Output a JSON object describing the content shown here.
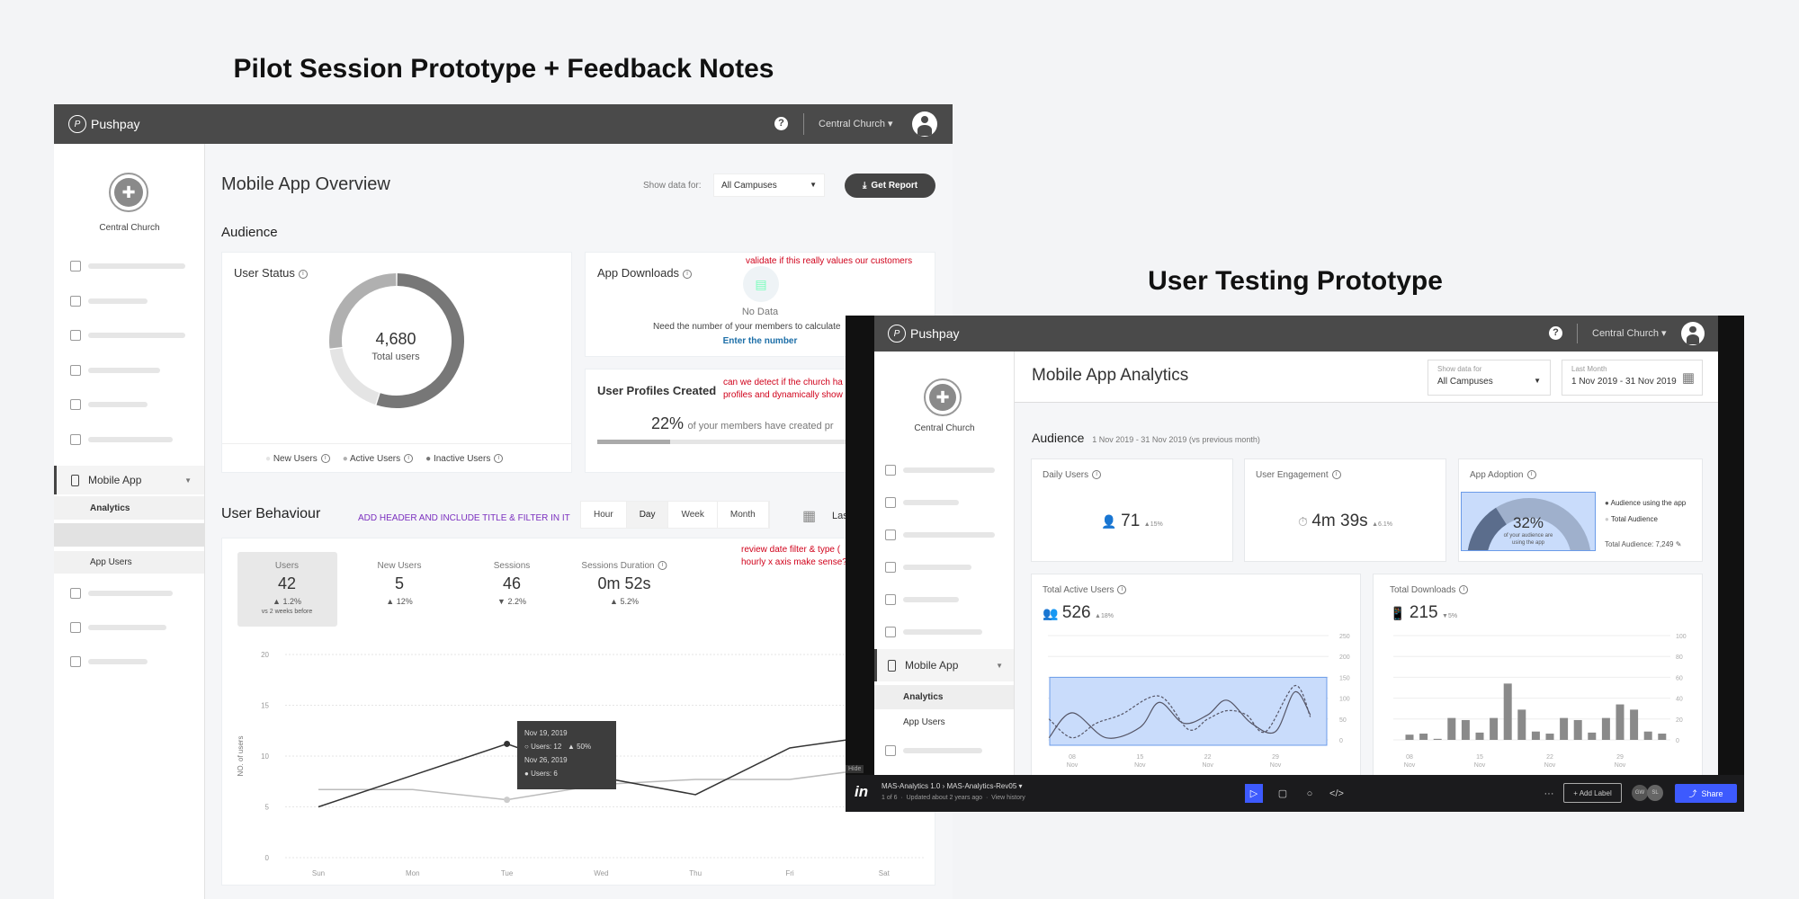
{
  "headings": {
    "left": "Pilot Session Prototype + Feedback Notes",
    "right": "User Testing Prototype"
  },
  "pilot": {
    "topbar": {
      "brand": "Pushpay",
      "help": "?",
      "church": "Central Church ▾"
    },
    "sidebar": {
      "church": "Central Church",
      "mobile_app": "Mobile App",
      "analytics": "Analytics",
      "app_users": "App Users"
    },
    "page_title": "Mobile App Overview",
    "show_data_label": "Show data for:",
    "campus_select": "All Campuses",
    "get_report": "Get Report",
    "audience": "Audience",
    "user_status": {
      "title": "User Status",
      "total": "4,680",
      "total_label": "Total users",
      "segments": [
        {
          "name": "Inactive Users",
          "fraction": 0.55,
          "color": "#777777"
        },
        {
          "name": "New Users",
          "fraction": 0.18,
          "color": "#e4e4e4"
        },
        {
          "name": "Active Users",
          "fraction": 0.27,
          "color": "#b0b0b0"
        }
      ],
      "legend": [
        "New Users",
        "Active Users",
        "Inactive Users"
      ]
    },
    "app_downloads": {
      "title": "App Downloads",
      "no_data": "No Data",
      "message": "Need the number of your members to calculate",
      "link": "Enter the number",
      "note": "validate if this really values our customers"
    },
    "user_profiles": {
      "title": "User Profiles Created",
      "percent": "22%",
      "text": "of your members have created pr",
      "progress": 0.22,
      "note": [
        "can we detect if the church ha",
        "profiles and dynamically show"
      ]
    },
    "behaviour": {
      "title": "User Behaviour",
      "note": "ADD HEADER AND INCLUDE TITLE & FILTER IN IT",
      "tabs": [
        "Hour",
        "Day",
        "Week",
        "Month"
      ],
      "selected_tab": "Day",
      "date_partial": "Las",
      "stats": [
        {
          "label": "Users",
          "value": "42",
          "change": "▲ 1.2%",
          "sub": "vs 2 weeks before"
        },
        {
          "label": "New Users",
          "value": "5",
          "change": "▲ 12%"
        },
        {
          "label": "Sessions",
          "value": "46",
          "change": "▼ 2.2%"
        },
        {
          "label": "Sessions Duration",
          "value": "0m 52s",
          "change": "▲ 5.2%"
        }
      ],
      "note2": [
        "review date filter & type (",
        "hourly x axis make sense?"
      ],
      "tooltip": {
        "date1": "Nov 19, 2019",
        "users1": "Users: 12",
        "change1": "▲ 50%",
        "date2": "Nov 26, 2019",
        "users2": "Users: 6"
      }
    }
  },
  "testing": {
    "topbar": {
      "brand": "Pushpay",
      "help": "?",
      "church": "Central Church ▾"
    },
    "sidebar": {
      "church": "Central Church",
      "mobile_app": "Mobile App",
      "analytics": "Analytics",
      "app_users": "App Users"
    },
    "page_title": "Mobile App Analytics",
    "show_data": {
      "label": "Show data for",
      "value": "All Campuses"
    },
    "date_filter": {
      "label": "Last Month",
      "value": "1 Nov 2019 - 31 Nov 2019"
    },
    "audience": "Audience",
    "audience_range": "1 Nov 2019 - 31 Nov 2019 (vs previous month)",
    "daily_users": {
      "title": "Daily Users",
      "value": "71",
      "change": "▲15%"
    },
    "engagement": {
      "title": "User Engagement",
      "value": "4m 39s",
      "change": "▲6.1%"
    },
    "adoption": {
      "title": "App Adoption",
      "percent": "32%",
      "caption": "of your audience are using the app",
      "fraction": 0.32,
      "legend": [
        "Audience using the app",
        "Total Audience"
      ],
      "total": "Total Audience: 7,249"
    },
    "active_users": {
      "title": "Total Active Users",
      "value": "526",
      "change": "▲18%"
    },
    "downloads": {
      "title": "Total Downloads",
      "value": "215",
      "change": "▼5%"
    },
    "hide": "Hide",
    "invision": {
      "logo": "in",
      "breadcrumb": "MAS-Analytics 1.0 › MAS-Analytics-Rev05 ▾",
      "meta": "1 of 6  ·  Updated about 2 years ago  ·  View history",
      "more": "···",
      "add_label": "+ Add Label",
      "avatars": [
        "GW",
        "SL"
      ],
      "share": "Share"
    }
  },
  "chart_data": [
    {
      "type": "line",
      "ylabel": "NO. of users",
      "categories": [
        "Sun",
        "Mon",
        "Tue",
        "Wed",
        "Thu",
        "Fri",
        "Sat"
      ],
      "ylim": [
        0,
        20
      ],
      "yticks": [
        0,
        5,
        10,
        15,
        20
      ],
      "grid": true,
      "series": [
        {
          "values": [
            5,
            8.1,
            11.2,
            7.9,
            6.2,
            10.8,
            12.1
          ],
          "color": "#333333"
        },
        {
          "values": [
            6.7,
            6.7,
            5.7,
            7.2,
            7.7,
            7.7,
            8.9
          ],
          "color": "#bbbbbb"
        }
      ]
    },
    {
      "type": "line",
      "xticks": [
        {
          "day": 8,
          "label": [
            "08",
            "Nov"
          ]
        },
        {
          "day": 15,
          "label": [
            "15",
            "Nov"
          ]
        },
        {
          "day": 22,
          "label": [
            "22",
            "Nov"
          ]
        },
        {
          "day": 29,
          "label": [
            "29",
            "Nov"
          ]
        }
      ],
      "ylim": [
        0,
        250
      ],
      "yticks": [
        0,
        50,
        100,
        150,
        200,
        250
      ],
      "grid": true,
      "series": [
        {
          "style": "solid",
          "x": [
            5.6,
            8,
            11.5,
            15,
            17,
            19.5,
            22,
            24,
            26.5,
            29,
            31,
            32.6
          ],
          "values": [
            5,
            65,
            5,
            30,
            90,
            40,
            60,
            95,
            40,
            20,
            115,
            60
          ]
        },
        {
          "style": "dashed",
          "x": [
            5.6,
            8,
            10.5,
            13,
            17,
            20,
            22,
            24,
            26,
            28,
            31,
            32.6
          ],
          "values": [
            50,
            5,
            40,
            60,
            105,
            25,
            50,
            70,
            60,
            20,
            130,
            55
          ]
        }
      ],
      "selection_ylim": [
        0,
        150
      ]
    },
    {
      "type": "bar",
      "ylim": [
        0,
        100
      ],
      "yticks": [
        0,
        20,
        40,
        60,
        80,
        100
      ],
      "grid": true,
      "xticks": [
        {
          "index": 0,
          "label": [
            "08",
            "Nov"
          ]
        },
        {
          "index": 5,
          "label": [
            "15",
            "Nov"
          ]
        },
        {
          "index": 10,
          "label": [
            "22",
            "Nov"
          ]
        },
        {
          "index": 15,
          "label": [
            "29",
            "Nov"
          ]
        }
      ],
      "values": [
        5,
        6,
        1,
        21,
        19,
        7,
        21,
        54,
        29,
        8,
        6,
        21,
        19,
        7,
        21,
        34,
        29,
        8,
        6
      ]
    }
  ]
}
